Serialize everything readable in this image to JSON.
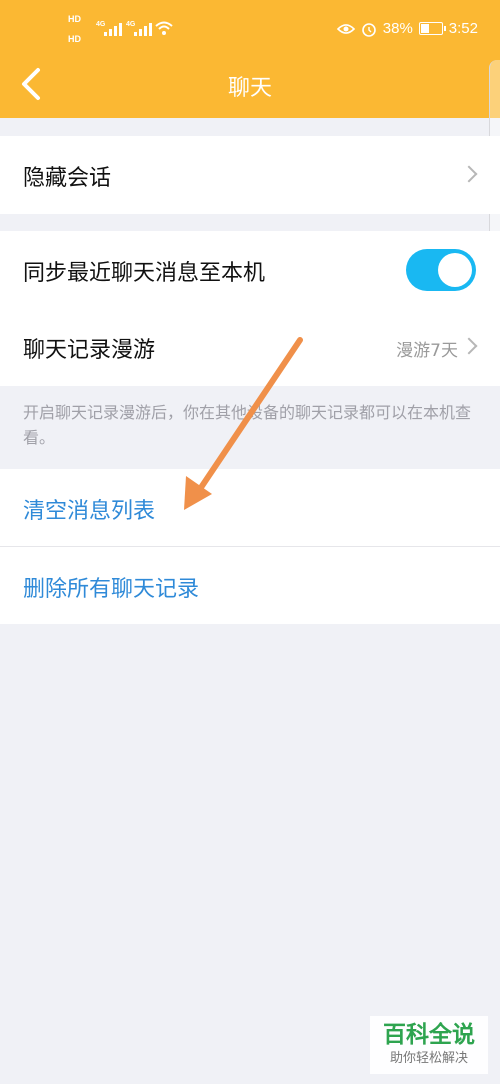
{
  "status_bar": {
    "signal_top": "HD",
    "signal_bottom": "HD",
    "net1": "4G",
    "net2": "4G",
    "battery_percent": "38%",
    "battery_level": 0.38,
    "time": "3:52",
    "icons": [
      "eye-icon",
      "alarm-icon",
      "wifi-icon",
      "signal-icon"
    ]
  },
  "header": {
    "title": "聊天",
    "back_icon": "chevron-left-icon",
    "background": "#fbb833"
  },
  "group1": {
    "hide_chat_label": "隐藏会话"
  },
  "group2": {
    "sync_label": "同步最近聊天消息至本机",
    "sync_enabled": true,
    "roaming_label": "聊天记录漫游",
    "roaming_value": "漫游7天"
  },
  "note": "开启聊天记录漫游后，你在其他设备的聊天记录都可以在本机查看。",
  "group3": {
    "clear_label": "清空消息列表",
    "delete_label": "删除所有聊天记录"
  },
  "colors": {
    "accent_blue": "#2f8ad8",
    "toggle_on": "#19b8f2",
    "annotation_arrow": "#f0904a"
  },
  "watermark": {
    "title": "百科全说",
    "subtitle": "助你轻松解决"
  }
}
